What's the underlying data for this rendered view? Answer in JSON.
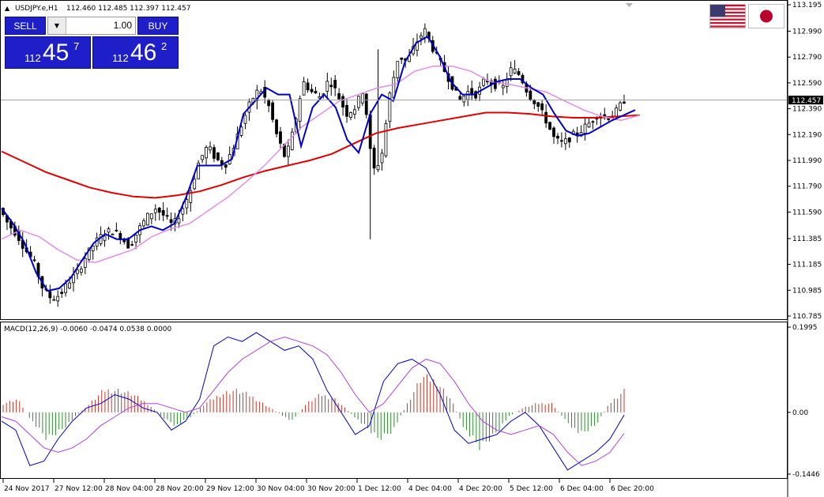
{
  "header": {
    "marker": "▲",
    "symbol": "USDJPY.e,H1",
    "ohlc": "112.460 112.485 112.397 112.457"
  },
  "trade_panel": {
    "sell_label": "SELL",
    "buy_label": "BUY",
    "lots": "1.00",
    "sell_price": {
      "small": "112",
      "big": "45",
      "sup": "7"
    },
    "buy_price": {
      "small": "112",
      "big": "46",
      "sup": "2"
    }
  },
  "flags": [
    "us-flag-icon",
    "japan-flag-icon"
  ],
  "colors": {
    "candles": "#000000",
    "ma_red": "#e00000",
    "ma_blue": "#0000c8",
    "ma_violet": "#e08ee6",
    "macd_pos": "#c0392b",
    "macd_neg": "#2e8b2e",
    "macd_main": "#0000c8",
    "macd_signal": "#b040d8",
    "button_blue": "#1f1fc9"
  },
  "price_axis": {
    "labels": [
      "113.195",
      "112.990",
      "112.790",
      "112.590",
      "112.390",
      "112.190",
      "111.990",
      "111.790",
      "111.590",
      "111.385",
      "111.185",
      "110.985",
      "110.785"
    ],
    "current": "112.457"
  },
  "macd_panel": {
    "label": "MACD(12,26,9) -0.0060 -0.0474 0.0538 0.0000",
    "axis_labels": [
      "0.1995",
      "0.00",
      "-0.1446"
    ]
  },
  "time_axis": {
    "labels": [
      "24 Nov 2017",
      "27 Nov 12:00",
      "28 Nov 04:00",
      "28 Nov 20:00",
      "29 Nov 12:00",
      "30 Nov 04:00",
      "30 Nov 20:00",
      "1 Dec 12:00",
      "4 Dec 04:00",
      "4 Dec 20:00",
      "5 Dec 12:00",
      "6 Dec 04:00",
      "6 Dec 20:00"
    ]
  },
  "chart_data": {
    "type": "candlestick",
    "symbol": "USDJPY.e",
    "timeframe": "H1",
    "ylim": [
      110.785,
      113.195
    ],
    "close_path": [
      111.62,
      111.5,
      111.42,
      111.3,
      111.2,
      111.0,
      110.92,
      110.95,
      111.05,
      111.12,
      111.25,
      111.35,
      111.42,
      111.45,
      111.4,
      111.32,
      111.45,
      111.55,
      111.62,
      111.56,
      111.48,
      111.6,
      111.75,
      111.98,
      112.1,
      112.0,
      111.95,
      112.1,
      112.28,
      112.45,
      112.55,
      112.42,
      112.18,
      112.0,
      112.25,
      112.6,
      112.52,
      112.48,
      112.62,
      112.5,
      112.35,
      112.4,
      112.55,
      111.9,
      112.0,
      112.5,
      112.8,
      112.75,
      112.9,
      113.0,
      112.85,
      112.72,
      112.6,
      112.45,
      112.52,
      112.5,
      112.62,
      112.58,
      112.55,
      112.7,
      112.65,
      112.5,
      112.42,
      112.3,
      112.15,
      112.12,
      112.18,
      112.22,
      112.28,
      112.35,
      112.32,
      112.36,
      112.457
    ],
    "ma_red_path": [
      112.06,
      111.98,
      111.9,
      111.84,
      111.78,
      111.74,
      111.71,
      111.7,
      111.72,
      111.75,
      111.8,
      111.86,
      111.91,
      111.95,
      111.99,
      112.04,
      112.12,
      112.2,
      112.24,
      112.27,
      112.3,
      112.33,
      112.36,
      112.36,
      112.35,
      112.33,
      112.32,
      112.32,
      112.33,
      112.34
    ],
    "ma_blue_path": [
      111.62,
      111.5,
      111.35,
      111.12,
      110.98,
      111.0,
      111.08,
      111.22,
      111.35,
      111.42,
      111.38,
      111.38,
      111.45,
      111.48,
      111.45,
      111.5,
      111.7,
      111.95,
      111.95,
      111.95,
      112.0,
      112.35,
      112.45,
      112.55,
      112.5,
      112.5,
      112.1,
      112.4,
      112.5,
      112.4,
      112.15,
      112.05,
      112.35,
      112.5,
      112.45,
      112.75,
      112.9,
      112.95,
      112.8,
      112.6,
      112.5,
      112.5,
      112.55,
      112.6,
      112.62,
      112.62,
      112.55,
      112.5,
      112.35,
      112.22,
      112.18,
      112.2,
      112.25,
      112.3,
      112.34,
      112.38
    ],
    "ma_violet_path": [
      111.38,
      111.45,
      111.4,
      111.3,
      111.22,
      111.2,
      111.25,
      111.3,
      111.4,
      111.46,
      111.5,
      111.6,
      111.7,
      111.82,
      111.95,
      112.1,
      112.25,
      112.35,
      112.45,
      112.5,
      112.55,
      112.58,
      112.68,
      112.72,
      112.72,
      112.68,
      112.6,
      112.58,
      112.55,
      112.52,
      112.45,
      112.38,
      112.33,
      112.3,
      112.34
    ],
    "macd": {
      "label": "MACD(12,26,9)",
      "values": {
        "macd": -0.006,
        "signal": -0.0474,
        "osma": 0.0538,
        "extra": 0.0
      },
      "ylim": [
        -0.1446,
        0.1995
      ],
      "histogram_path": [
        0.02,
        0.03,
        -0.02,
        -0.06,
        -0.04,
        -0.01,
        0.02,
        0.05,
        0.05,
        0.04,
        0.02,
        -0.01,
        -0.03,
        -0.01,
        0.02,
        0.04,
        0.05,
        0.04,
        0.02,
        0.0,
        -0.02,
        0.02,
        0.04,
        0.03,
        0.0,
        -0.03,
        -0.06,
        -0.04,
        0.02,
        0.08,
        0.07,
        0.03,
        -0.04,
        -0.08,
        -0.05,
        -0.01,
        0.01,
        0.02,
        0.02,
        -0.02,
        -0.05,
        -0.03,
        0.02,
        0.05
      ],
      "macd_path": [
        -0.02,
        -0.04,
        -0.12,
        -0.11,
        -0.06,
        -0.02,
        0.01,
        0.02,
        0.04,
        0.03,
        0.01,
        0.0,
        -0.04,
        -0.02,
        0.03,
        0.15,
        0.17,
        0.16,
        0.18,
        0.16,
        0.14,
        0.15,
        0.12,
        0.05,
        0.0,
        -0.05,
        -0.03,
        0.07,
        0.11,
        0.12,
        0.1,
        0.04,
        -0.04,
        -0.07,
        -0.06,
        -0.05,
        -0.02,
        0.0,
        -0.03,
        -0.08,
        -0.13,
        -0.11,
        -0.09,
        -0.06,
        -0.006
      ],
      "signal_path": [
        -0.01,
        -0.02,
        -0.05,
        -0.08,
        -0.09,
        -0.08,
        -0.06,
        -0.03,
        -0.01,
        0.01,
        0.02,
        0.02,
        0.01,
        0.0,
        0.01,
        0.05,
        0.09,
        0.12,
        0.14,
        0.16,
        0.17,
        0.16,
        0.15,
        0.13,
        0.09,
        0.04,
        0.0,
        0.02,
        0.06,
        0.1,
        0.12,
        0.11,
        0.07,
        0.02,
        -0.02,
        -0.04,
        -0.05,
        -0.04,
        -0.03,
        -0.05,
        -0.09,
        -0.12,
        -0.11,
        -0.09,
        -0.0474
      ]
    }
  }
}
